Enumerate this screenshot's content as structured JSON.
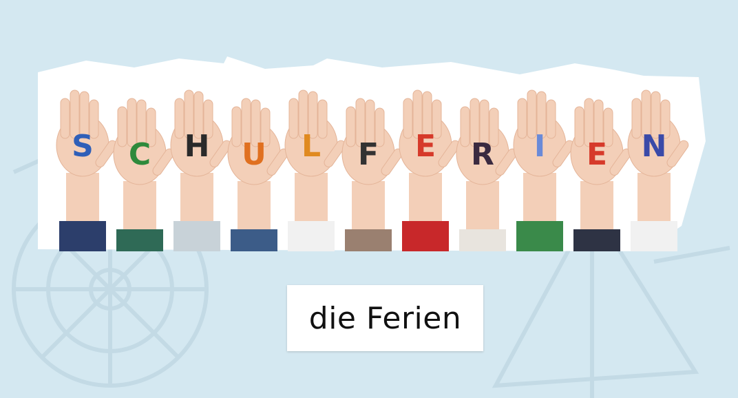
{
  "colors": {
    "background": "#d4e8f1",
    "watermark": "#c3dae5",
    "card": "#ffffff",
    "skin": "#f3cfb8",
    "skin_shade": "#e4b498"
  },
  "photo": {
    "hand_letters": [
      "S",
      "C",
      "H",
      "U",
      "L",
      "F",
      "E",
      "R",
      "I",
      "E",
      "N"
    ],
    "letter_colors": [
      "#2f5fb8",
      "#2e8a3c",
      "#2a2a2a",
      "#e07020",
      "#e08a20",
      "#333333",
      "#d63a2a",
      "#3a2a40",
      "#6a8ad8",
      "#d63a2a",
      "#3a4aa8"
    ]
  },
  "caption": {
    "text": "die Ferien"
  }
}
